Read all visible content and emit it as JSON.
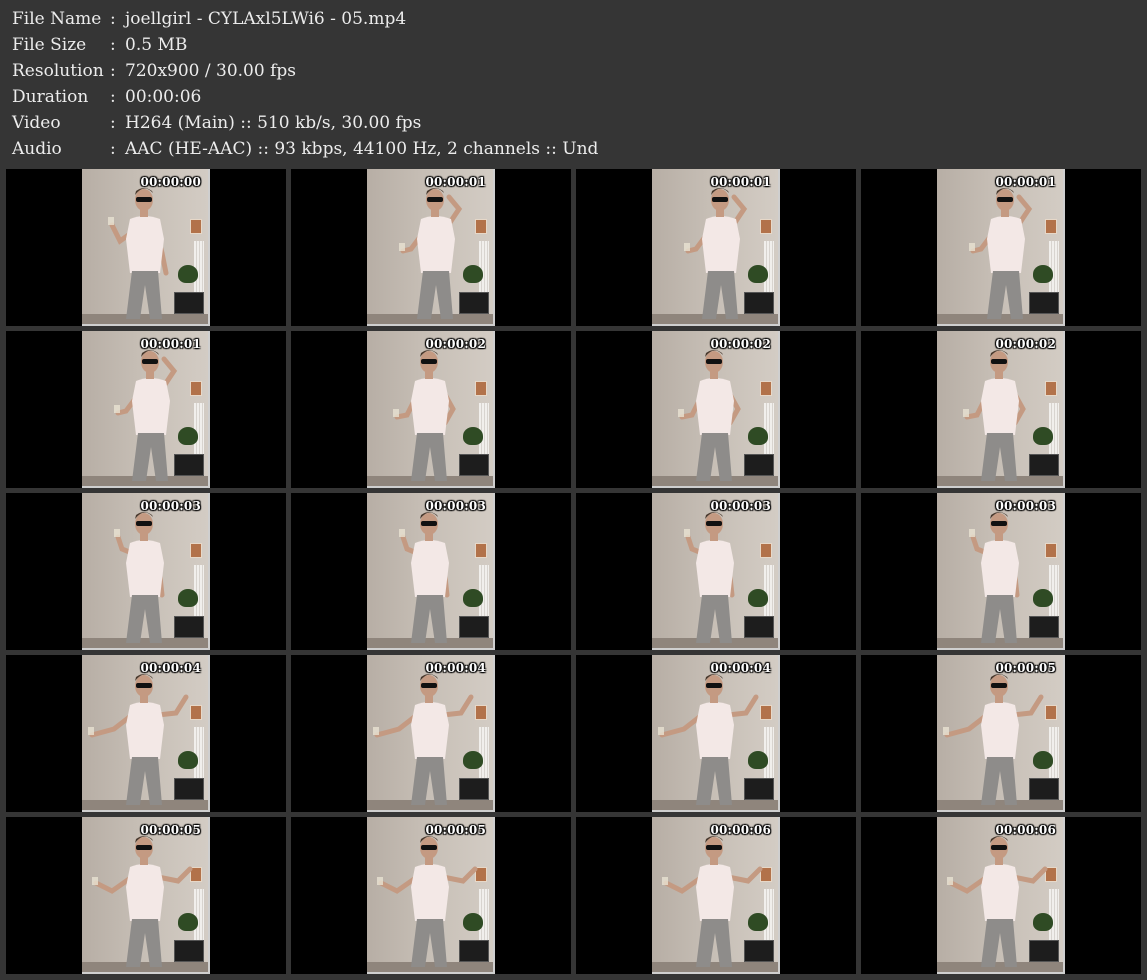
{
  "info": [
    {
      "key": "File Name",
      "sep": ":",
      "value": "joellgirl - CYLAxl5LWi6 - 05.mp4"
    },
    {
      "key": "File Size",
      "sep": ":",
      "value": "0.5 MB"
    },
    {
      "key": "Resolution",
      "sep": ":",
      "value": "720x900 / 30.00 fps"
    },
    {
      "key": "Duration",
      "sep": ":",
      "value": "00:00:06"
    },
    {
      "key": "Video",
      "sep": ":",
      "value": "H264 (Main) :: 510 kb/s, 30.00 fps"
    },
    {
      "key": "Audio",
      "sep": ":",
      "value": "AAC (HE-AAC) :: 93 kbps, 44100 Hz, 2 channels :: Und"
    }
  ],
  "frames": [
    {
      "time": "00:00:00",
      "pose": "glass-near"
    },
    {
      "time": "00:00:01",
      "pose": "arm-up"
    },
    {
      "time": "00:00:01",
      "pose": "arm-up"
    },
    {
      "time": "00:00:01",
      "pose": "arm-up"
    },
    {
      "time": "00:00:01",
      "pose": "arm-up"
    },
    {
      "time": "00:00:02",
      "pose": "hip"
    },
    {
      "time": "00:00:02",
      "pose": "hip"
    },
    {
      "time": "00:00:02",
      "pose": "hip"
    },
    {
      "time": "00:00:03",
      "pose": "glass-up"
    },
    {
      "time": "00:00:03",
      "pose": "glass-up"
    },
    {
      "time": "00:00:03",
      "pose": "glass-up"
    },
    {
      "time": "00:00:03",
      "pose": "glass-up"
    },
    {
      "time": "00:00:04",
      "pose": "arms-open"
    },
    {
      "time": "00:00:04",
      "pose": "arms-open"
    },
    {
      "time": "00:00:04",
      "pose": "arms-open"
    },
    {
      "time": "00:00:05",
      "pose": "arms-open"
    },
    {
      "time": "00:00:05",
      "pose": "shrug"
    },
    {
      "time": "00:00:05",
      "pose": "shrug"
    },
    {
      "time": "00:00:06",
      "pose": "shrug"
    },
    {
      "time": "00:00:06",
      "pose": "shrug"
    }
  ],
  "colors": {
    "background": "#353535",
    "cell": "#000000",
    "text": "#ececec",
    "shirt": "#f3e8e6",
    "pants": "#8e8c8a",
    "skin": "#c49a82",
    "hair": "#4a3a2e"
  }
}
